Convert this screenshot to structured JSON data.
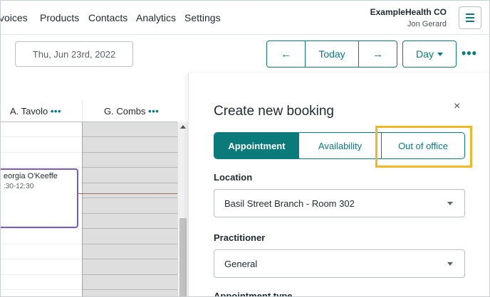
{
  "nav": {
    "links": [
      "voices",
      "Products",
      "Contacts",
      "Analytics",
      "Settings"
    ],
    "org_name": "ExampleHealth CO",
    "user_name": "Jon Gerard"
  },
  "toolbar": {
    "date": "Thu, Jun 23rd, 2022",
    "prev_label": "←",
    "today_label": "Today",
    "next_label": "→",
    "view_label": "Day",
    "more_label": "•••"
  },
  "calendar": {
    "columns": [
      {
        "name": "A. Tavolo",
        "dots": "•••"
      },
      {
        "name": "G. Combs",
        "dots": "•••"
      }
    ],
    "appointment": {
      "name": "eorgia O'Keeffe",
      "time": ":30-12:30"
    }
  },
  "booking": {
    "title": "Create new booking",
    "close_label": "×",
    "tabs": [
      {
        "label": "Appointment",
        "active": true
      },
      {
        "label": "Availability",
        "active": false
      },
      {
        "label": "Out of office",
        "active": false
      }
    ],
    "location_label": "Location",
    "location_value": "Basil Street Branch - Room 302",
    "practitioner_label": "Practitioner",
    "practitioner_value": "General",
    "next_label": "Appointment type"
  },
  "colors": {
    "accent": "#0b7a7a",
    "highlight": "#f2b824",
    "appointment_border": "#7a5cb5",
    "unavailable": "#dedede"
  }
}
